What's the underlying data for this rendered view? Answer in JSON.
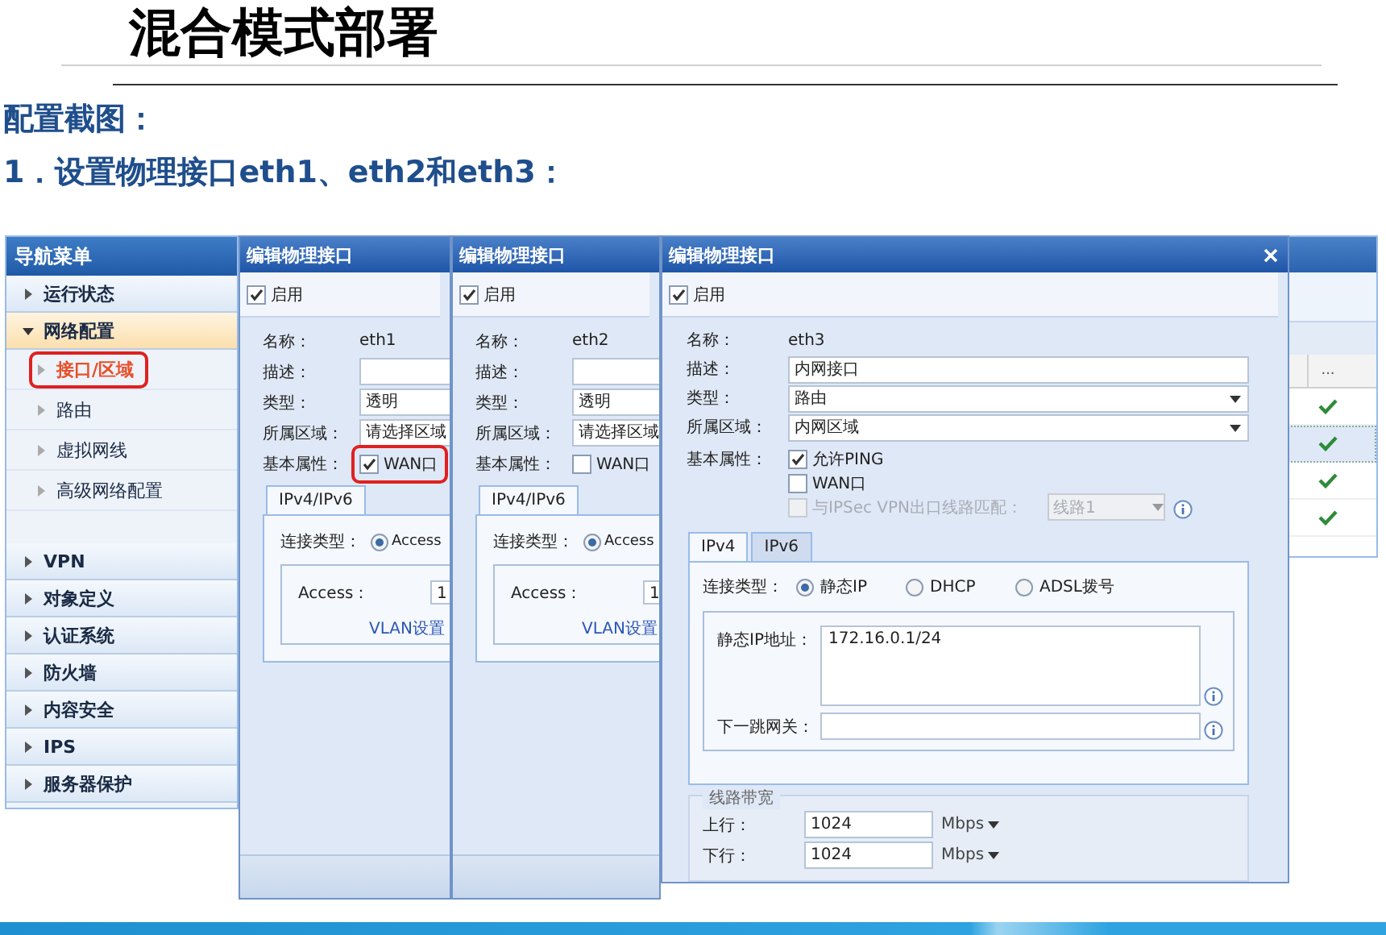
{
  "slide": {
    "title": "混合模式部署",
    "subtitle": "配置截图：",
    "step": "1．设置物理接口eth1、eth2和eth3："
  },
  "nav": {
    "title": "导航菜单",
    "items": [
      {
        "label": "运行状态",
        "expanded": false
      },
      {
        "label": "网络配置",
        "expanded": true,
        "children": [
          {
            "label": "接口/区域",
            "selected": true,
            "annotated": true
          },
          {
            "label": "路由",
            "selected": false
          },
          {
            "label": "虚拟网线",
            "selected": false
          },
          {
            "label": "高级网络配置",
            "selected": false
          }
        ]
      },
      {
        "label": "VPN",
        "expanded": false
      },
      {
        "label": "对象定义",
        "expanded": false
      },
      {
        "label": "认证系统",
        "expanded": false
      },
      {
        "label": "防火墙",
        "expanded": false
      },
      {
        "label": "内容安全",
        "expanded": false
      },
      {
        "label": "IPS",
        "expanded": false
      },
      {
        "label": "服务器保护",
        "expanded": false
      }
    ]
  },
  "background_table": {
    "column_header": "...",
    "rows": [
      {
        "checked": true,
        "selected": false
      },
      {
        "checked": true,
        "selected": true
      },
      {
        "checked": true,
        "selected": false
      },
      {
        "checked": true,
        "selected": false
      }
    ]
  },
  "dialogs": [
    {
      "kind": "transparent",
      "title": "编辑物理接口",
      "enable": {
        "label": "启用",
        "checked": true
      },
      "fields": {
        "name_label": "名称：",
        "name": "eth1",
        "desc_label": "描述：",
        "type_label": "类型：",
        "type": "透明",
        "zone_label": "所属区域：",
        "zone": "请选择区域",
        "props_label": "基本属性："
      },
      "wan": {
        "label": "WAN口",
        "checked": true,
        "annotated": true
      },
      "tabs": [
        {
          "label": "IPv4/IPv6",
          "selected": true
        }
      ],
      "conn_label": "连接类型：",
      "conn_options": [
        {
          "label": "Access",
          "selected": true
        }
      ],
      "access_label": "Access：",
      "access_value": "1",
      "vlan_link": "VLAN设置"
    },
    {
      "kind": "transparent",
      "title": "编辑物理接口",
      "enable": {
        "label": "启用",
        "checked": true
      },
      "fields": {
        "name_label": "名称：",
        "name": "eth2",
        "desc_label": "描述：",
        "type_label": "类型：",
        "type": "透明",
        "zone_label": "所属区域：",
        "zone": "请选择区域",
        "props_label": "基本属性："
      },
      "wan": {
        "label": "WAN口",
        "checked": false
      },
      "tabs": [
        {
          "label": "IPv4/IPv6",
          "selected": true
        }
      ],
      "conn_label": "连接类型：",
      "conn_options": [
        {
          "label": "Access",
          "selected": true
        }
      ],
      "access_label": "Access：",
      "access_value": "1",
      "vlan_link": "VLAN设置"
    },
    {
      "kind": "routed",
      "title": "编辑物理接口",
      "enable": {
        "label": "启用",
        "checked": true
      },
      "fields": {
        "name_label": "名称：",
        "name": "eth3",
        "desc_label": "描述：",
        "desc": "内网接口",
        "type_label": "类型：",
        "type": "路由",
        "zone_label": "所属区域：",
        "zone": "内网区域",
        "props_label": "基本属性："
      },
      "options": [
        {
          "label": "允许PING",
          "checked": true,
          "disabled": false
        },
        {
          "label": "WAN口",
          "checked": false,
          "disabled": false
        },
        {
          "label": "与IPSec VPN出口线路匹配：",
          "checked": false,
          "disabled": true,
          "line_select": "线路1"
        }
      ],
      "tabs": [
        {
          "label": "IPv4",
          "selected": true
        },
        {
          "label": "IPv6",
          "selected": false
        }
      ],
      "conn_label": "连接类型：",
      "conn_options": [
        {
          "label": "静态IP",
          "selected": true
        },
        {
          "label": "DHCP",
          "selected": false
        },
        {
          "label": "ADSL拨号",
          "selected": false
        }
      ],
      "static_ip_label": "静态IP地址：",
      "static_ip": "172.16.0.1/24",
      "gateway_label": "下一跳网关：",
      "bandwidth": {
        "title": "线路带宽",
        "rows": [
          {
            "label": "上行：",
            "value": "1024",
            "unit": "Mbps"
          },
          {
            "label": "下行：",
            "value": "1024",
            "unit": "Mbps"
          }
        ]
      }
    }
  ]
}
